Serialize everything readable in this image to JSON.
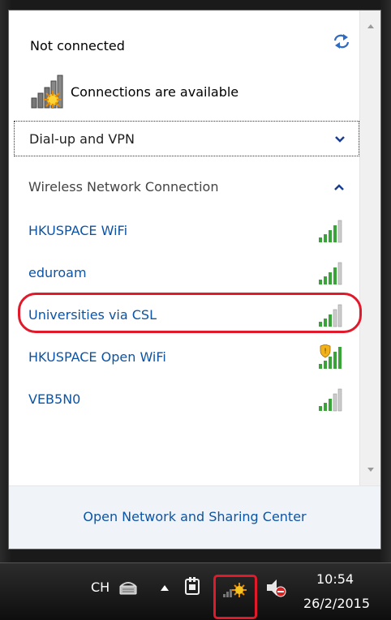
{
  "flyout": {
    "status": "Not connected",
    "connections_text": "Connections are available",
    "dialup_label": "Dial-up and VPN",
    "wireless_label": "Wireless Network Connection",
    "networks": [
      {
        "name": "HKUSPACE WiFi",
        "secured": false
      },
      {
        "name": "eduroam",
        "secured": false
      },
      {
        "name": "Universities via CSL",
        "secured": false,
        "highlighted": true
      },
      {
        "name": "HKUSPACE Open WiFi",
        "secured": true
      },
      {
        "name": "VEB5N0",
        "secured": false
      }
    ],
    "footer_link": "Open Network and Sharing Center"
  },
  "taskbar": {
    "language": "CH",
    "time": "10:54",
    "date": "26/2/2015"
  },
  "colors": {
    "link": "#0b54a6",
    "annotation": "#e01a2a",
    "signal_green": "#3aa33a"
  }
}
